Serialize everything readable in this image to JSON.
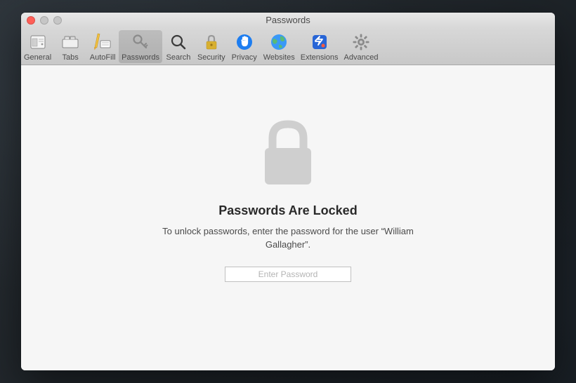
{
  "window": {
    "title": "Passwords"
  },
  "toolbar": {
    "items": [
      {
        "label": "General"
      },
      {
        "label": "Tabs"
      },
      {
        "label": "AutoFill"
      },
      {
        "label": "Passwords"
      },
      {
        "label": "Search"
      },
      {
        "label": "Security"
      },
      {
        "label": "Privacy"
      },
      {
        "label": "Websites"
      },
      {
        "label": "Extensions"
      },
      {
        "label": "Advanced"
      }
    ],
    "selected_index": 3
  },
  "content": {
    "heading": "Passwords Are Locked",
    "subtext": "To unlock passwords, enter the password for the user “William Gallagher”.",
    "password_placeholder": "Enter Password"
  },
  "colors": {
    "privacy_blue": "#1d7df0",
    "websites_blue": "#3a99f7",
    "extensions_blue": "#2865d6"
  }
}
